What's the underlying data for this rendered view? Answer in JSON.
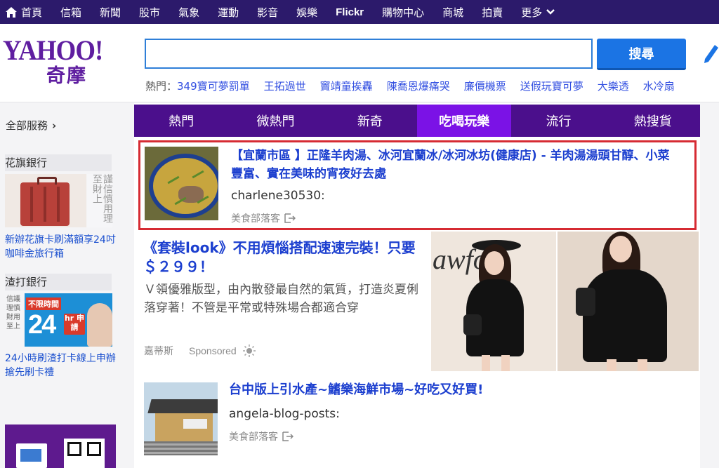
{
  "topnav": {
    "items": [
      "首頁",
      "信箱",
      "新聞",
      "股市",
      "氣象",
      "運動",
      "影音",
      "娛樂",
      "Flickr",
      "購物中心",
      "商城",
      "拍賣",
      "更多"
    ]
  },
  "header": {
    "logo_en": "YAHOO!",
    "logo_zh": "奇摩",
    "search_value": "",
    "search_button": "搜尋",
    "trending_label": "熱門：",
    "trending": [
      "349寶可夢罰單",
      "王拓過世",
      "竇靖童挨轟",
      "陳喬恩爆痛哭",
      "廉價機票",
      "送假玩寶可夢",
      "大樂透",
      "水冷扇"
    ]
  },
  "left": {
    "all_services": "全部服務",
    "ad1_title": "花旗銀行",
    "ad1_side": "謹信慎用理至財上",
    "ad1_caption": "新辦花旗卡刷滿額享24吋咖啡金旅行箱",
    "ad2_title": "渣打銀行",
    "ad2_side": "信議理慎財用至上",
    "ad2_badge": "不限時間",
    "ad2_big": "24",
    "ad2_hr": "hr 申請",
    "ad2_caption": "24小時刷渣打卡線上申辦搶先刷卡禮"
  },
  "tabs": [
    {
      "label": "熱門",
      "active": false
    },
    {
      "label": "微熱門",
      "active": false
    },
    {
      "label": "新奇",
      "active": false
    },
    {
      "label": "吃喝玩樂",
      "active": true
    },
    {
      "label": "流行",
      "active": false
    },
    {
      "label": "熱搜貨",
      "active": false
    }
  ],
  "cards": {
    "card1": {
      "title": "【宜蘭市區 】正隆羊肉湯、冰河宜蘭冰/冰河冰坊(健康店) - 羊肉湯湯頭甘醇、小菜豐富、實在美味的宵夜好去處",
      "author": "charlene30530:",
      "source": "美食部落客"
    },
    "card2": {
      "title": "《套裝look》不用煩惱搭配速速完裝！只要＄２９９！",
      "desc": "Ｖ領優雅版型，由內散發最自然的氣質，打造炎夏俐落穿著！不管是平常或特殊場合都適合穿",
      "source": "嘉蒂斯",
      "sponsored": "Sponsored",
      "photo_text": "awfo"
    },
    "card3": {
      "title": "台中版上引水產~鰭樂海鮮市場~好吃又好買!",
      "author": "angela-blog-posts:",
      "source": "美食部落客"
    }
  },
  "colors": {
    "topnav_bg": "#2c1a6b",
    "tabs_bg": "#4b0f8c",
    "tab_active": "#7b12e6",
    "link": "#1c3fcf",
    "highlight_border": "#d62b33",
    "search_button": "#1b74e4"
  },
  "icons": [
    "home-icon",
    "chevron-down-icon",
    "pencil-icon",
    "chevron-right-icon",
    "share-icon",
    "sun-icon"
  ]
}
